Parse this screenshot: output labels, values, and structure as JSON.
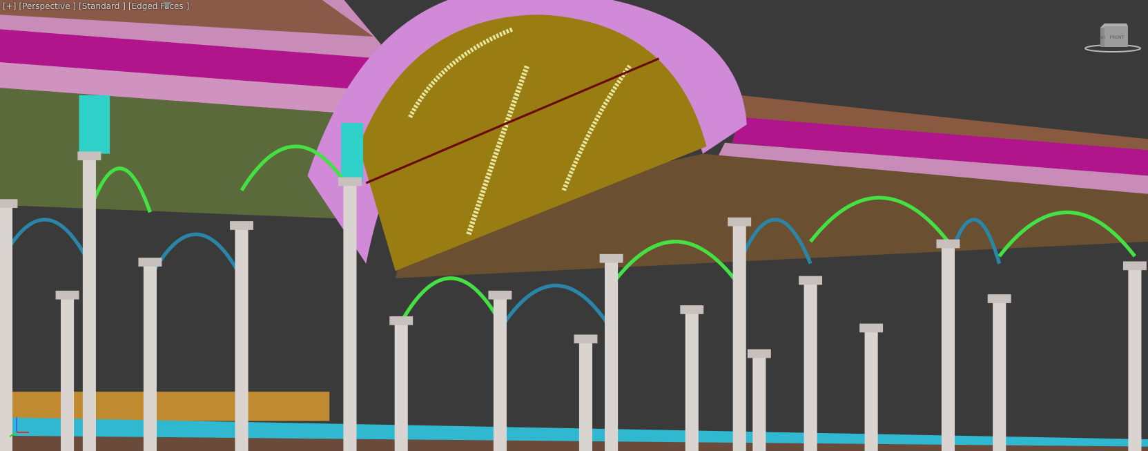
{
  "viewport": {
    "menu_plus": "[+]",
    "view_label": "[Perspective ]",
    "shading_label": "[Standard ]",
    "display_label": "[Edged Faces ]",
    "filter_icon": "filter-icon"
  },
  "viewcube": {
    "face_front": "FRONT",
    "face_left": "LEFT"
  },
  "colors": {
    "background": "#3a3a3a",
    "vault": "#9a7d12",
    "roof_pink": "#d68cc8",
    "magenta": "#b0158c",
    "column": "#d9d4d0",
    "cyan": "#2fc8d0",
    "green": "#44e044",
    "teal_arch": "#2a86a8",
    "brown": "#7a4a30"
  }
}
